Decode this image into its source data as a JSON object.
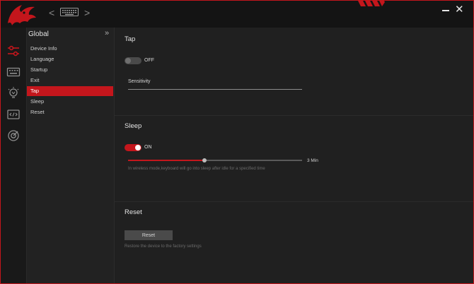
{
  "titlebar": {
    "device_name": "",
    "prev_symbol": "<",
    "next_symbol": ">",
    "close_symbol": "✕"
  },
  "submenu": {
    "title": "Global",
    "collapse_symbol": "»",
    "items": [
      {
        "label": "Device Info"
      },
      {
        "label": "Language"
      },
      {
        "label": "Startup"
      },
      {
        "label": "Exit"
      },
      {
        "label": "Tap",
        "active": true
      },
      {
        "label": "Sleep"
      },
      {
        "label": "Reset"
      }
    ]
  },
  "tap": {
    "title": "Tap",
    "toggle_state": "OFF",
    "sensitivity_label": "Sensitivity"
  },
  "sleep": {
    "title": "Sleep",
    "toggle_state": "ON",
    "slider_fraction": 0.44,
    "value_label": "3 Min",
    "hint": "In wireless mode,keyboard will go into sleep after idle for a specified time"
  },
  "reset": {
    "title": "Reset",
    "button_label": "Reset",
    "hint": "Restore the device to the factory settings"
  },
  "colors": {
    "accent": "#c4161c",
    "background": "#1f1f1f"
  }
}
